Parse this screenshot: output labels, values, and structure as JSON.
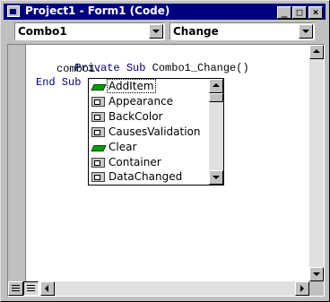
{
  "window": {
    "title": "Project1 - Form1 (Code)",
    "minimize": "_",
    "maximize": "□",
    "close": "×"
  },
  "object_combo": {
    "value": "Combo1"
  },
  "procedure_combo": {
    "value": "Change"
  },
  "code": {
    "line1_kw": "Private Sub",
    "line1_rest": " Combo1_Change()",
    "line2": "combo1.",
    "line3_kw": "End Sub"
  },
  "autocomplete": {
    "items": [
      {
        "label": "AddItem",
        "icon": "method-icon"
      },
      {
        "label": "Appearance",
        "icon": "property-icon"
      },
      {
        "label": "BackColor",
        "icon": "property-icon"
      },
      {
        "label": "CausesValidation",
        "icon": "property-icon"
      },
      {
        "label": "Clear",
        "icon": "method-icon"
      },
      {
        "label": "Container",
        "icon": "property-icon"
      },
      {
        "label": "DataChanged",
        "icon": "property-icon"
      }
    ],
    "selected_index": 0
  },
  "colors": {
    "title_bar": "#000080",
    "keyword": "#000080",
    "face": "#c0c0c0"
  }
}
